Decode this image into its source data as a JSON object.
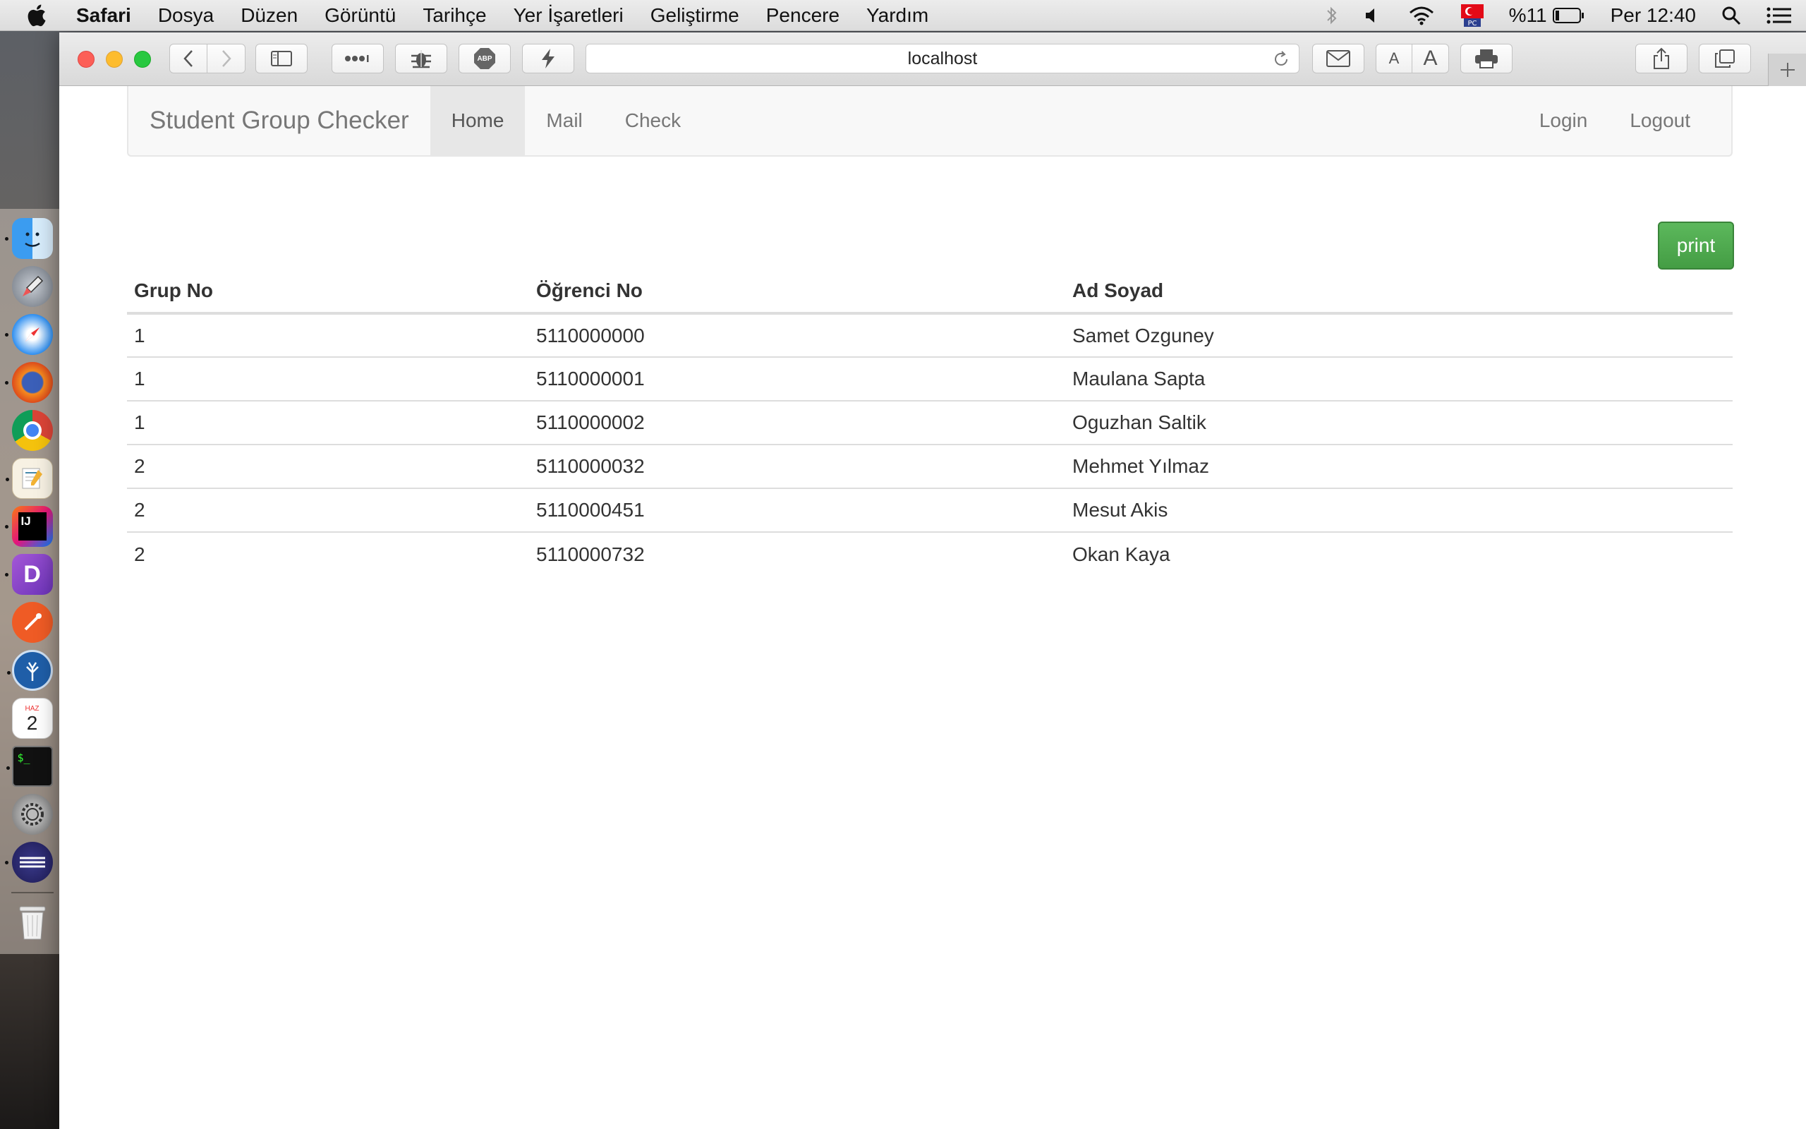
{
  "menubar": {
    "app": "Safari",
    "items": [
      "Dosya",
      "Düzen",
      "Görüntü",
      "Tarihçe",
      "Yer İşaretleri",
      "Geliştirme",
      "Pencere",
      "Yardım"
    ],
    "battery": "%11",
    "clock": "Per 12:40"
  },
  "dock": {
    "calendar_month": "HAZ",
    "calendar_day": "2",
    "terminal_prompt": "$_",
    "intellij_label": "IJ",
    "dash_label": "D"
  },
  "browser": {
    "url": "localhost",
    "font_small": "A",
    "font_large": "A",
    "adblock_label": "ABP"
  },
  "navbar": {
    "brand": "Student Group Checker",
    "links": [
      "Home",
      "Mail",
      "Check"
    ],
    "login": "Login",
    "logout": "Logout"
  },
  "print_label": "print",
  "table": {
    "headers": [
      "Grup No",
      "Öğrenci No",
      "Ad Soyad"
    ],
    "rows": [
      [
        "1",
        "5110000000",
        "Samet Ozguney"
      ],
      [
        "1",
        "5110000001",
        "Maulana Sapta"
      ],
      [
        "1",
        "5110000002",
        "Oguzhan Saltik"
      ],
      [
        "2",
        "5110000032",
        "Mehmet Yılmaz"
      ],
      [
        "2",
        "5110000451",
        "Mesut Akis"
      ],
      [
        "2",
        "5110000732",
        "Okan Kaya"
      ]
    ]
  },
  "colors": {
    "success": "#5cb85c",
    "navbar_bg": "#f8f8f8",
    "nav_active": "#e7e7e7"
  }
}
